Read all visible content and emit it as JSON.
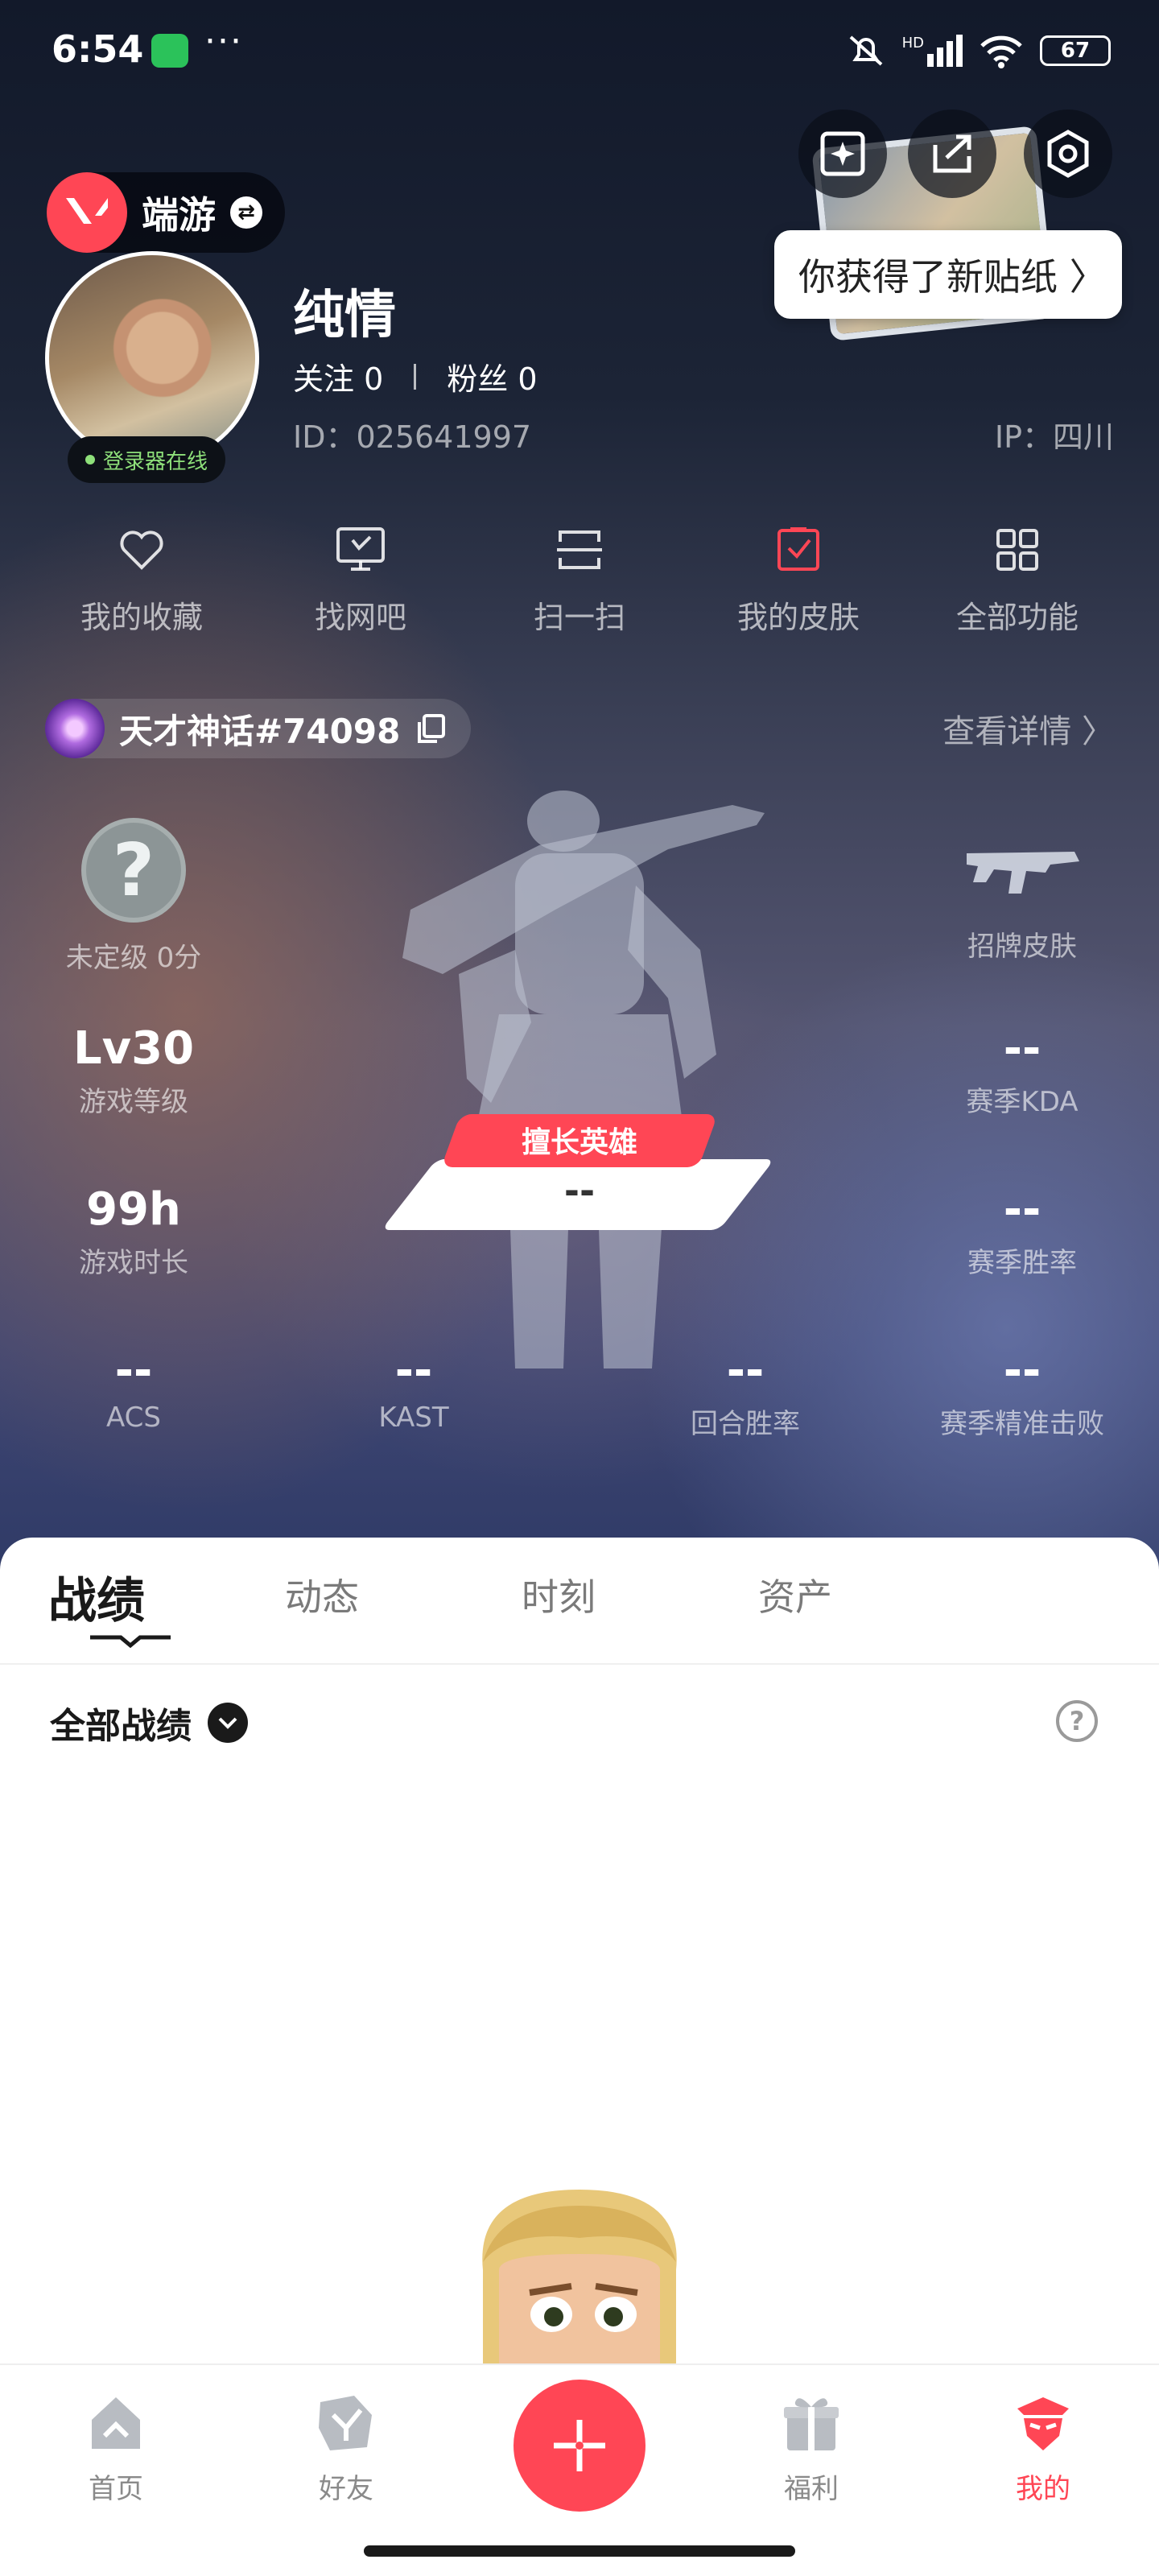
{
  "status_bar": {
    "time": "6:54",
    "more": "···",
    "battery": "67",
    "signal_tag": "HD"
  },
  "header": {
    "toast": "你获得了新贴纸 〉",
    "game_tag": {
      "label": "端游"
    },
    "online_status": "登录器在线",
    "nickname": "纯情",
    "follow": {
      "following": "关注 0",
      "fans": "粉丝 0"
    },
    "user_id": "ID：025641997",
    "ip": "IP：四川"
  },
  "quick_actions": [
    {
      "label": "我的收藏",
      "icon": "heart-icon"
    },
    {
      "label": "找网吧",
      "icon": "monitor-icon"
    },
    {
      "label": "扫一扫",
      "icon": "scan-icon"
    },
    {
      "label": "我的皮肤",
      "icon": "skin-icon"
    },
    {
      "label": "全部功能",
      "icon": "grid-icon"
    }
  ],
  "profile_game": {
    "riot_id": "天才神话#74098",
    "detail_link": "查看详情 〉",
    "rank": {
      "value": "未定级 0分"
    },
    "signature_skin": {
      "label": "招牌皮肤"
    },
    "level": {
      "value": "Lv30",
      "label": "游戏等级"
    },
    "playtime": {
      "value": "99h",
      "label": "游戏时长"
    },
    "kda": {
      "value": "--",
      "label": "赛季KDA"
    },
    "winrate": {
      "value": "--",
      "label": "赛季胜率"
    },
    "best_hero": {
      "tag": "擅长英雄",
      "value": "--"
    },
    "bottom_stats": [
      {
        "value": "--",
        "label": "ACS"
      },
      {
        "value": "--",
        "label": "KAST"
      },
      {
        "value": "--",
        "label": "回合胜率"
      },
      {
        "value": "--",
        "label": "赛季精准击败"
      }
    ]
  },
  "tabs": [
    {
      "label": "战绩",
      "active": true
    },
    {
      "label": "动态",
      "active": false
    },
    {
      "label": "时刻",
      "active": false
    },
    {
      "label": "资产",
      "active": false
    }
  ],
  "records": {
    "filter_label": "全部战绩"
  },
  "bottom_nav": [
    {
      "label": "首页",
      "icon": "home-icon",
      "active": false
    },
    {
      "label": "好友",
      "icon": "friends-icon",
      "active": false
    },
    {
      "label": "",
      "icon": "plus-icon",
      "active": false
    },
    {
      "label": "福利",
      "icon": "gift-icon",
      "active": false
    },
    {
      "label": "我的",
      "icon": "profile-icon",
      "active": true
    }
  ],
  "colors": {
    "accent": "#ff4655",
    "online": "#8ee07a",
    "wechat": "#2bc25a"
  }
}
